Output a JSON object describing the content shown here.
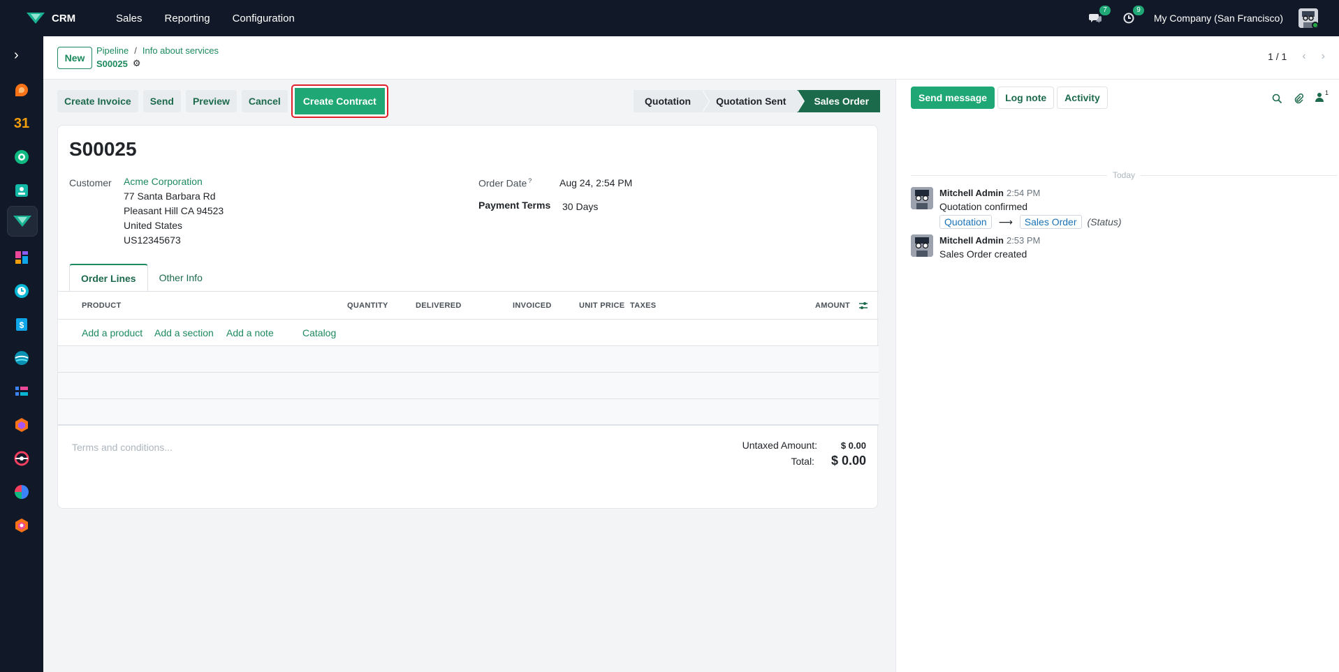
{
  "navbar": {
    "app_name": "CRM",
    "menu": [
      "Sales",
      "Reporting",
      "Configuration"
    ],
    "messages_count": "7",
    "activities_count": "9",
    "company": "My Company (San Francisco)"
  },
  "sidebar": {
    "apps": [
      "discuss",
      "calendar",
      "contacts",
      "hr",
      "crm",
      "dashboards",
      "timesheets",
      "invoicing",
      "planning",
      "project",
      "inventory",
      "helpdesk",
      "spreadsheet",
      "fieldservice"
    ],
    "calendar_label": "31"
  },
  "control_panel": {
    "new_button": "New",
    "breadcrumb": [
      "Pipeline",
      "Info about services"
    ],
    "breadcrumb_sep": "/",
    "current": "S00025",
    "pager": "1 / 1"
  },
  "actions": {
    "create_invoice": "Create Invoice",
    "send": "Send",
    "preview": "Preview",
    "cancel": "Cancel",
    "create_contract": "Create Contract"
  },
  "status_bar": {
    "stages": [
      "Quotation",
      "Quotation Sent",
      "Sales Order"
    ],
    "active": "Sales Order"
  },
  "form": {
    "name": "S00025",
    "customer_label": "Customer",
    "customer_name": "Acme Corporation",
    "customer_address": [
      "77 Santa Barbara Rd",
      "Pleasant Hill CA 94523",
      "United States",
      "US12345673"
    ],
    "order_date_label": "Order Date",
    "order_date_help": "?",
    "order_date": "Aug 24, 2:54 PM",
    "payment_terms_label": "Payment Terms",
    "payment_terms": "30 Days",
    "tabs": [
      "Order Lines",
      "Other Info"
    ],
    "columns": [
      "PRODUCT",
      "QUANTITY",
      "DELIVERED",
      "INVOICED",
      "UNIT PRICE",
      "TAXES",
      "AMOUNT"
    ],
    "add_links": [
      "Add a product",
      "Add a section",
      "Add a note",
      "Catalog"
    ],
    "terms_placeholder": "Terms and conditions...",
    "untaxed_label": "Untaxed Amount:",
    "untaxed_value": "$ 0.00",
    "total_label": "Total:",
    "total_value": "$ 0.00"
  },
  "chatter": {
    "send_message": "Send message",
    "log_note": "Log note",
    "activity": "Activity",
    "followers_count": "1",
    "date_separator": "Today",
    "messages": [
      {
        "author": "Mitchell Admin",
        "time": "2:54 PM",
        "text": "Quotation confirmed",
        "from": "Quotation",
        "to": "Sales Order",
        "field": "(Status)"
      },
      {
        "author": "Mitchell Admin",
        "time": "2:53 PM",
        "text": "Sales Order created"
      }
    ]
  }
}
